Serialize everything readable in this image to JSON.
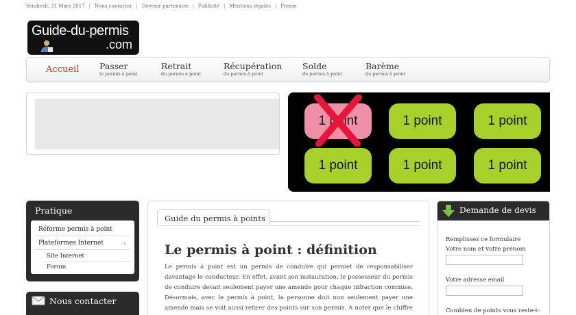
{
  "topbar": {
    "date": "Vendredi, 31 Mars 2017",
    "links": [
      "Nous contacter",
      "Devenir partenaire",
      "Publicité",
      "Mentions légales",
      "Presse"
    ]
  },
  "logo": {
    "line1": "Guide-du-permis",
    "line2": ".com"
  },
  "nav": {
    "home": "Accueil",
    "items": [
      {
        "title": "Passer",
        "sub": "le permis à point"
      },
      {
        "title": "Retrait",
        "sub": "du permis à point"
      },
      {
        "title": "Récupération",
        "sub": "du permis à point"
      },
      {
        "title": "Solde",
        "sub": "du permis à point"
      },
      {
        "title": "Barème",
        "sub": "du permis à point"
      }
    ]
  },
  "points_banner": {
    "buttons": [
      "1 point",
      "1 point",
      "1 point",
      "1 point",
      "1 point",
      "1 point"
    ],
    "lost_index": 0,
    "colors": {
      "point": "#a7d129",
      "lost": "#f090a6",
      "cross": "#e8143c"
    }
  },
  "pratique": {
    "title": "Pratique",
    "items": [
      "Réforme permis à point",
      "Plateformes Internet"
    ],
    "subitems": [
      "Site Internet",
      "Forum"
    ]
  },
  "contact": {
    "title": "Nous contacter"
  },
  "main": {
    "tab": "Guide du permis à points",
    "heading": "Le permis à point : définition",
    "paragraph": "Le permis à point est un permis de conduire qui permet de responsabiliser davantage le conducteur. En effet, avant son instauration, le possesseur du permis de conduire devait seulement payer une amende pour chaque infraction commise. Désormais, avec le permis à point, la personne doit non seulement payer une amende mais se voit aussi retirer des points sur son permis. A noter que le chiffre de"
  },
  "devis": {
    "title": "Demande de devis",
    "intro": "Remplissez ce formulaire",
    "label_name": "Votre nom et votre prénom",
    "label_email": "Votre adresse email",
    "label_points": "Combien de points vous reste-t-"
  }
}
